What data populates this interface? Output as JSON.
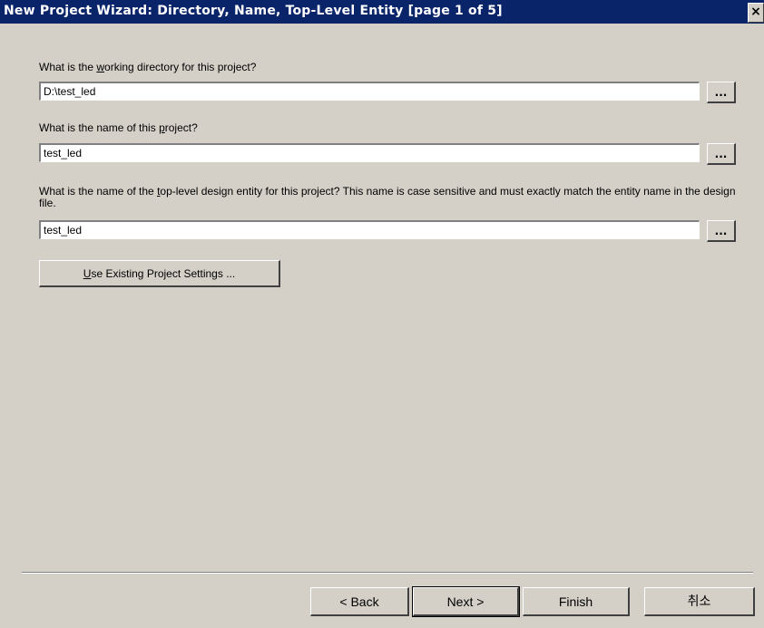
{
  "window": {
    "title": "New Project Wizard: Directory, Name, Top-Level Entity [page 1 of 5]",
    "close_glyph": "×"
  },
  "directory": {
    "label_pre": "What is the ",
    "label_accel": "w",
    "label_post": "orking directory for this project?",
    "value": "D:\\test_led",
    "browse_label": "..."
  },
  "project_name": {
    "label_pre": "What is the name of this ",
    "label_accel": "p",
    "label_post": "roject?",
    "value": "test_led",
    "browse_label": "..."
  },
  "top_level": {
    "label_pre": "What is the name of the ",
    "label_accel": "t",
    "label_post": "op-level design entity for this project? This name is case sensitive and must exactly match the entity name in the design file.",
    "value": "test_led",
    "browse_label": "..."
  },
  "settings_button": {
    "accel": "U",
    "rest": "se Existing Project Settings ..."
  },
  "footer": {
    "back_label": "< Back",
    "next_label": "Next >",
    "finish_label": "Finish",
    "cancel_label": "취소"
  }
}
